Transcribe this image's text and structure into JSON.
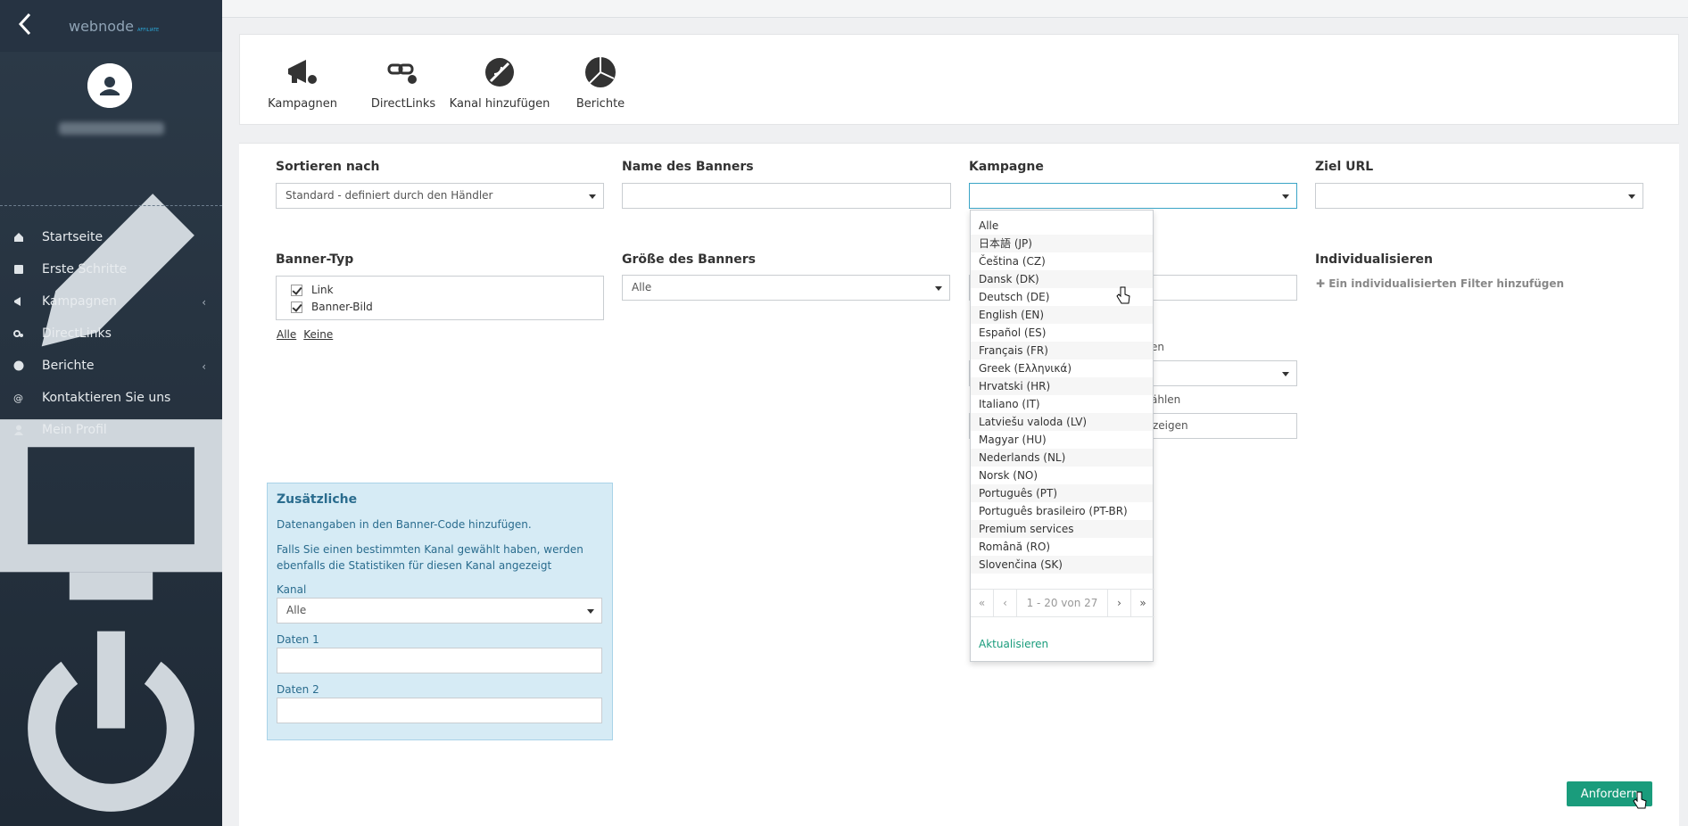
{
  "sidebar": {
    "logo": "webnode",
    "logo_sub": "AFFILIATE",
    "nav": [
      {
        "label": "Startseite",
        "icon": "home-icon",
        "submenu": false
      },
      {
        "label": "Erste Schritte",
        "icon": "book-icon",
        "submenu": false
      },
      {
        "label": "Kampagnen",
        "icon": "megaphone-icon",
        "submenu": true
      },
      {
        "label": "DirectLinks",
        "icon": "link-icon",
        "submenu": false
      },
      {
        "label": "Berichte",
        "icon": "pie-chart-icon",
        "submenu": true
      },
      {
        "label": "Kontaktieren Sie uns",
        "icon": "at-icon",
        "submenu": false
      },
      {
        "label": "Mein Profil",
        "icon": "user-icon",
        "submenu": false
      }
    ]
  },
  "toolbar": {
    "items": [
      {
        "label": "Kampagnen",
        "icon": "megaphone-icon"
      },
      {
        "label": "DirectLinks",
        "icon": "link-icon"
      },
      {
        "label": "Kanal hinzufügen",
        "icon": "satellite-icon"
      },
      {
        "label": "Berichte",
        "icon": "pie-chart-icon"
      }
    ]
  },
  "filters": {
    "sort_label": "Sortieren nach",
    "sort_value": "Standard - definiert durch den Händler",
    "name_label": "Name des Banners",
    "name_value": "",
    "campaign_label": "Kampagne",
    "campaign_value": "",
    "target_label": "Ziel URL",
    "target_value": "",
    "type_label": "Banner-Typ",
    "type_options": [
      "Link",
      "Banner-Bild"
    ],
    "all_link": "Alle",
    "none_link": "Keine",
    "size_label": "Größe des Banners",
    "size_value": "Alle",
    "custom_label": "Individualisieren",
    "custom_add": "Ein individualisierten Filter hinzufügen",
    "frag1": "en",
    "frag2": "ählen",
    "frag3": "zeigen"
  },
  "extra": {
    "title": "Zusätzliche",
    "text1": "Datenangaben in den Banner-Code hinzufügen.",
    "text2": "Falls Sie einen bestimmten Kanal gewählt haben, werden ebenfalls die Statistiken für diesen Kanal angezeigt",
    "channel_label": "Kanal",
    "channel_value": "Alle",
    "data1_label": "Daten 1",
    "data2_label": "Daten 2"
  },
  "dropdown": {
    "options": [
      "Alle",
      "日本語 (JP)",
      "Čeština (CZ)",
      "Dansk (DK)",
      "Deutsch (DE)",
      "English (EN)",
      "Español (ES)",
      "Français (FR)",
      "Greek (Ελληνικά)",
      "Hrvatski (HR)",
      "Italiano (IT)",
      "Latviešu valoda (LV)",
      "Magyar (HU)",
      "Nederlands (NL)",
      "Norsk (NO)",
      "Português (PT)",
      "Português brasileiro (PT-BR)",
      "Premium services",
      "Română (RO)",
      "Slovenčina (SK)"
    ],
    "pager": {
      "first": "«",
      "prev": "‹",
      "range": "1 - 20 von 27",
      "next": "›",
      "last": "»"
    },
    "refresh": "Aktualisieren"
  },
  "order_button": "Anfordern",
  "colors": {
    "accent": "#1a9c7c",
    "sidebar": "#2c3a48",
    "info_box": "#d6ebf5"
  }
}
